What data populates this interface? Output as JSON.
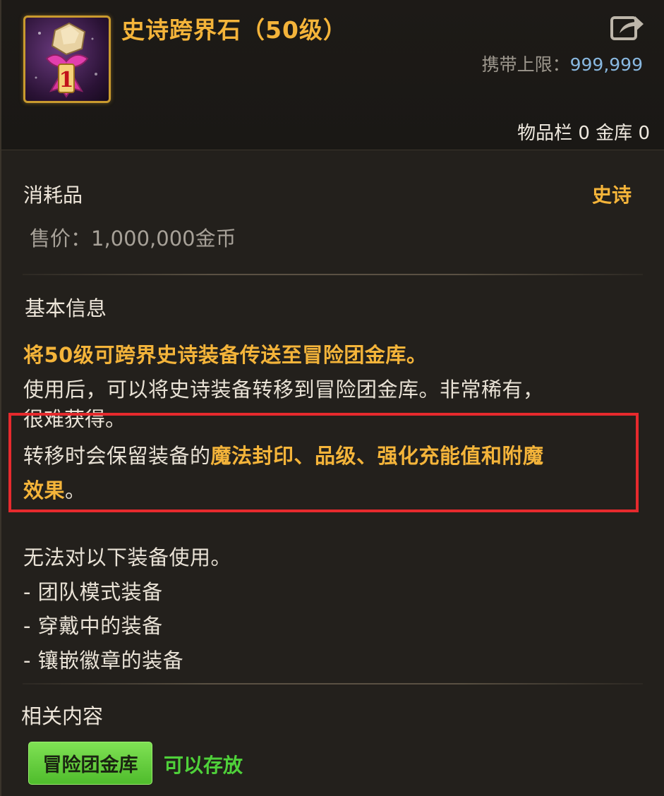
{
  "item": {
    "title": "史诗跨界石（50级）",
    "carry_limit_label": "携带上限：",
    "carry_limit_value": "999,999",
    "storage_label": "物品栏 0 金库 0",
    "icon": "epic-stone-gift-icon",
    "badge_number": "1"
  },
  "summary": {
    "type": "消耗品",
    "rarity": "史诗",
    "price": "售价：1,000,000金币"
  },
  "basic_info": {
    "title": "基本信息",
    "line1": "将50级可跨界史诗装备传送至冒险团金库。",
    "line2": "使用后，可以将史诗装备转移到冒险团金库。非常稀有，",
    "line3_partial": "很难获得。",
    "line4_prefix": "转移时会保留装备的",
    "line4_highlight": "魔法封印、品级、强化充能值和附魔",
    "line5_highlight": "效果",
    "line5_suffix": "。"
  },
  "restrictions": {
    "title": "无法对以下装备使用。",
    "items": [
      "- 团队模式装备",
      "- 穿戴中的装备",
      "- 镶嵌徽章的装备"
    ]
  },
  "related": {
    "title": "相关内容",
    "tag_label": "冒险团金库",
    "tag_status": "可以存放"
  },
  "colors": {
    "title_gold": "#f4b43a",
    "carry_value_blue": "#89b8e0",
    "highlight_border": "#e62a2d",
    "tag_green": "#5fcb36",
    "status_green": "#4fd13a"
  }
}
